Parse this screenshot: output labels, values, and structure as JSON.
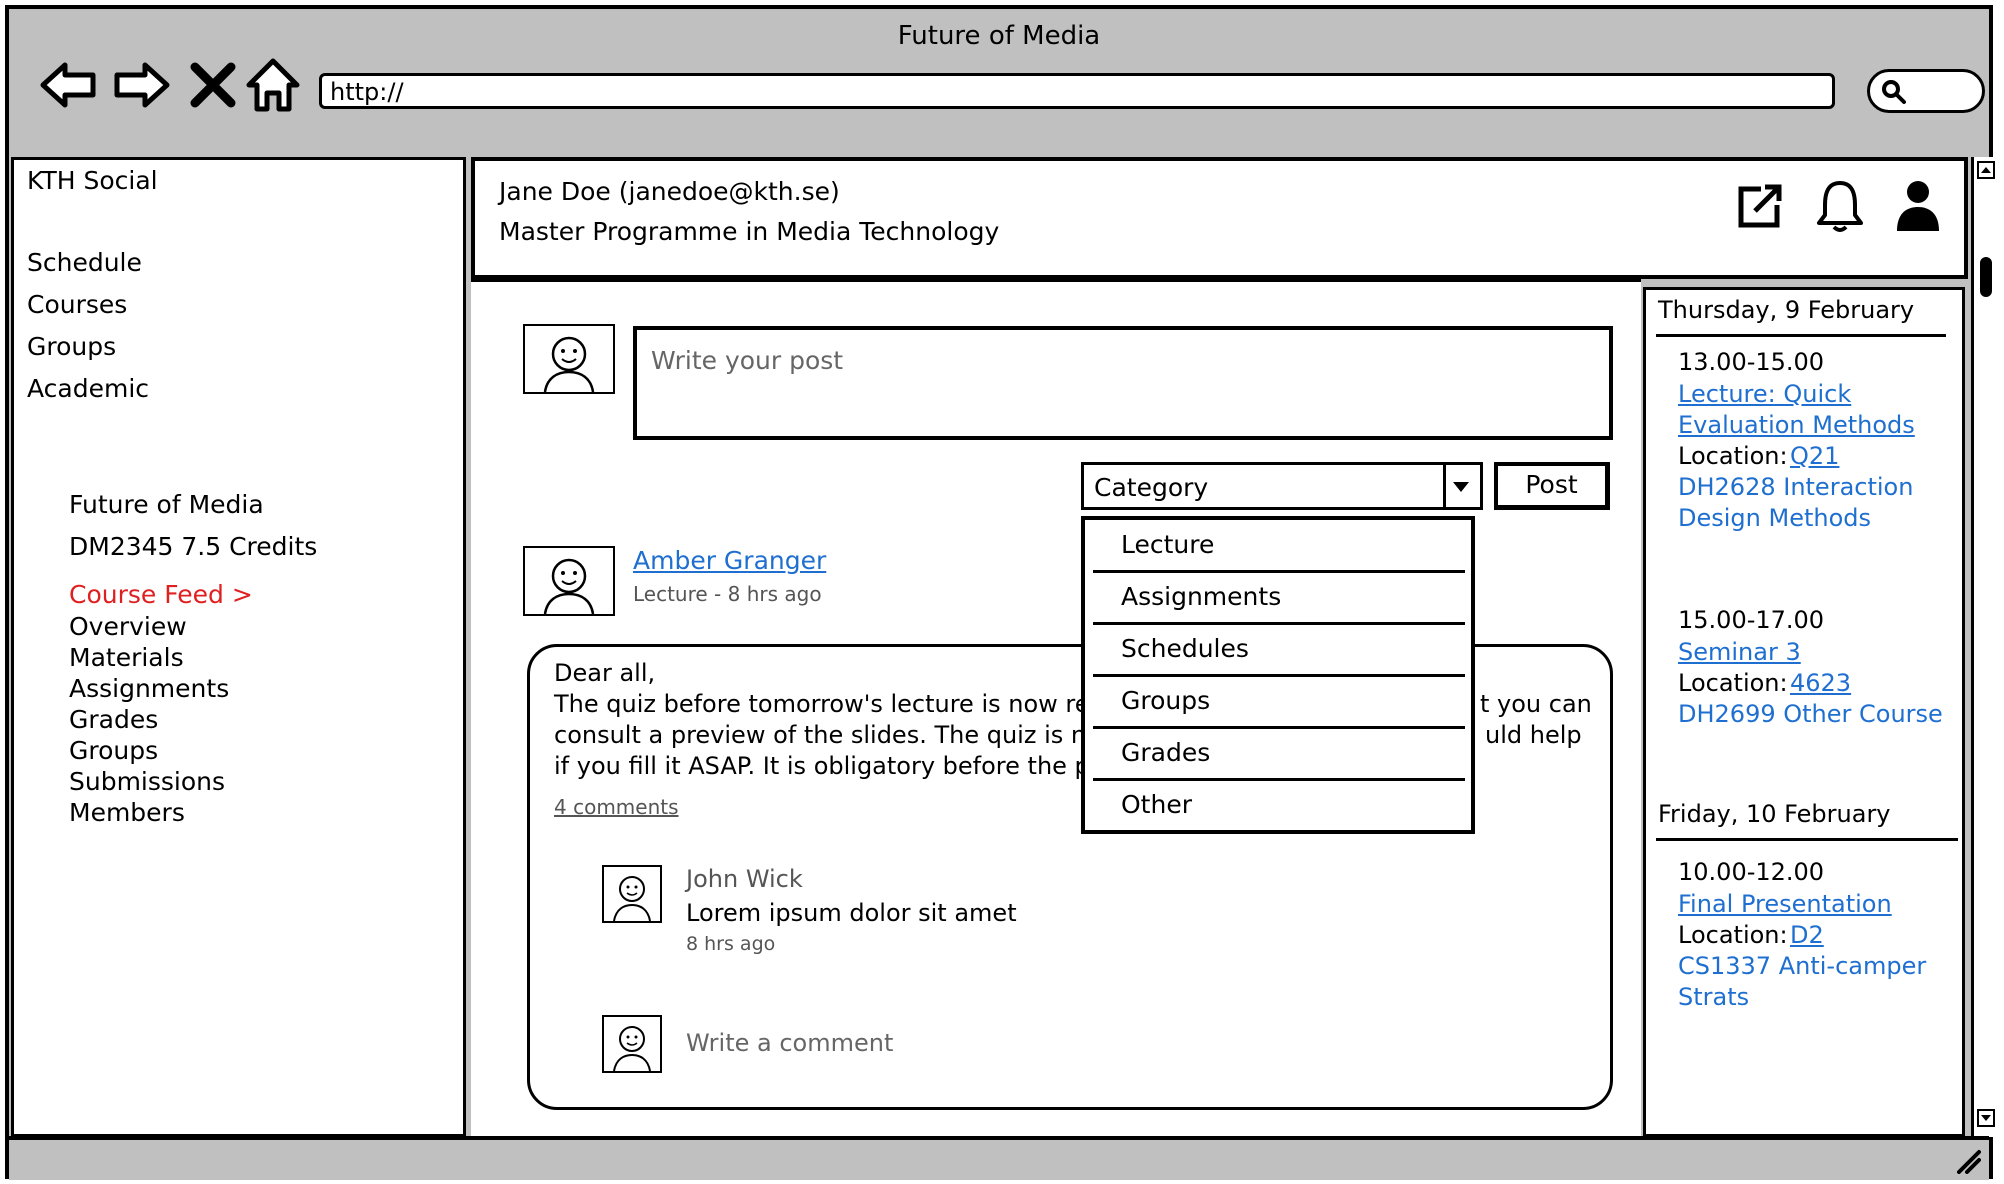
{
  "window": {
    "title": "Future of Media",
    "url": "http://"
  },
  "sidebar": {
    "brand": "KTH Social",
    "main_items": [
      "Schedule",
      "Courses",
      "Groups",
      "Academic"
    ],
    "course_title": "Future of Media",
    "course_code": "DM2345 7.5 Credits",
    "course_feed": "Course Feed >",
    "course_items": [
      "Overview",
      "Materials",
      "Assignments",
      "Grades",
      "Groups",
      "Submissions",
      "Members"
    ]
  },
  "header": {
    "user": "Jane Doe (janedoe@kth.se)",
    "programme": "Master Programme in Media Technology",
    "icons": [
      "external-link-icon",
      "bell-icon",
      "user-icon"
    ]
  },
  "composer": {
    "placeholder": "Write your post",
    "category_label": "Category",
    "post_button": "Post",
    "category_options": [
      "Lecture",
      "Assignments",
      "Schedules",
      "Groups",
      "Grades",
      "Other"
    ]
  },
  "post": {
    "author": "Amber Granger",
    "meta": "Lecture - 8 hrs ago",
    "greeting": "Dear all,",
    "line1a": "The quiz before tomorrow's lecture is now re",
    "line1b": "t you can",
    "line2a": "consult a preview of the slides. The quiz is n",
    "line2b": "uld help",
    "line3a": "if you fill it ASAP. It is obligatory  before the p",
    "comments_link": "4 comments",
    "comment": {
      "author": "John Wick",
      "text": "Lorem ipsum dolor sit amet",
      "time": "8 hrs ago"
    },
    "comment_placeholder": "Write a comment"
  },
  "schedule": {
    "day1": {
      "heading": "Thursday, 9 February",
      "e1": {
        "time": "13.00-15.00",
        "title_l1": "Lecture: Quick",
        "title_l2": "Evaluation Methods",
        "loc_label": "Location:",
        "loc": "Q21",
        "course_l1": "DH2628 Interaction",
        "course_l2": "Design Methods"
      },
      "e2": {
        "time": "15.00-17.00",
        "title": "Seminar 3",
        "loc_label": "Location:",
        "loc": "4623",
        "course": "DH2699 Other Course"
      }
    },
    "day2": {
      "heading": "Friday, 10 February",
      "e1": {
        "time": "10.00-12.00",
        "title": "Final Presentation",
        "loc_label": "Location:",
        "loc": "D2",
        "course_l1": "CS1337 Anti-camper",
        "course_l2": "Strats"
      }
    }
  }
}
